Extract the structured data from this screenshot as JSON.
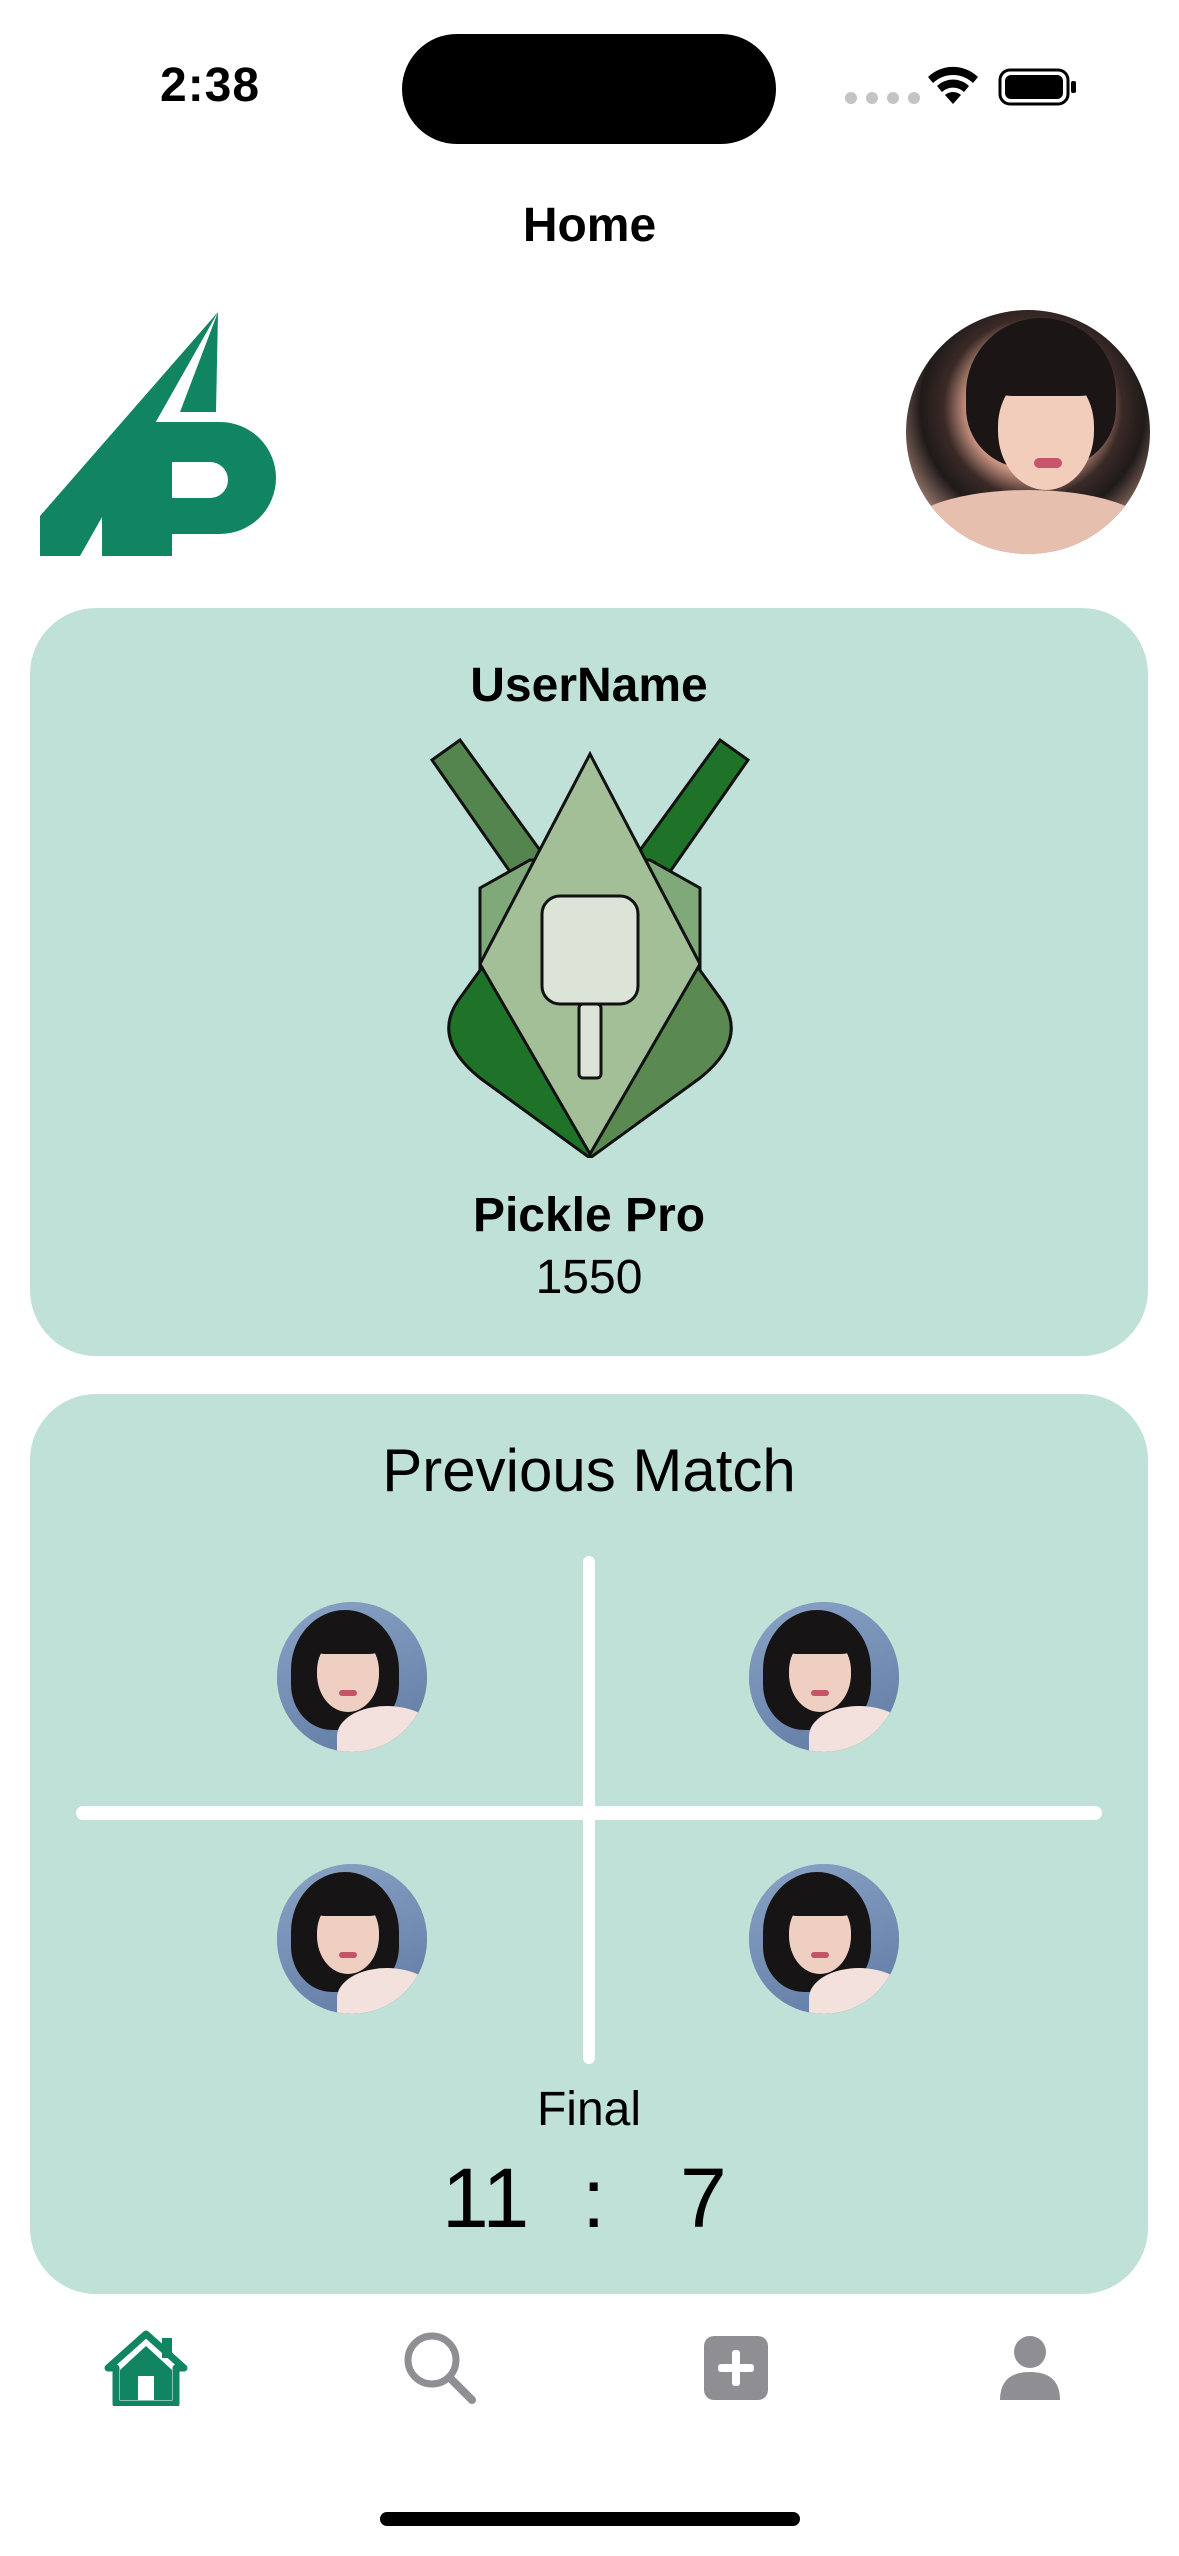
{
  "status_bar": {
    "time": "2:38"
  },
  "nav": {
    "title": "Home"
  },
  "profile_card": {
    "username": "UserName",
    "rank_name": "Pickle Pro",
    "rating": "1550"
  },
  "match_card": {
    "title": "Previous Match",
    "status": "Final",
    "score_team_a": "11",
    "score_separator": ":",
    "score_team_b": "7"
  },
  "tab_bar": {
    "items": [
      {
        "icon": "house-icon",
        "active": true
      },
      {
        "icon": "magnifying-glass-icon",
        "active": false
      },
      {
        "icon": "plus-square-icon",
        "active": false
      },
      {
        "icon": "person-icon",
        "active": false
      }
    ],
    "active_color": "#118562",
    "inactive_color": "#8e8e93"
  },
  "colors": {
    "card_background": "#c0e1d7",
    "brand_green": "#118562"
  }
}
